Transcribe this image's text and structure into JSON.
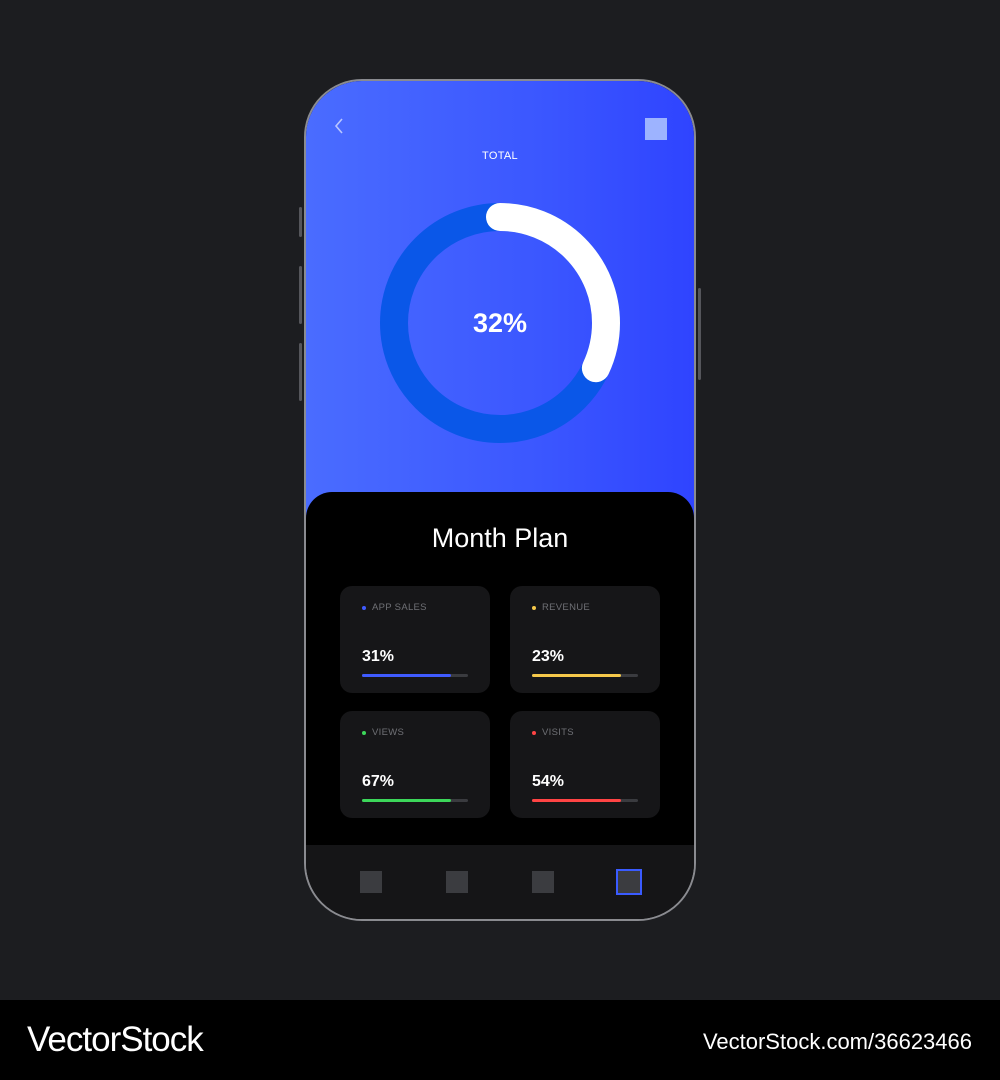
{
  "header": {
    "back_icon": "chevron-left-icon",
    "title": "TOTAL"
  },
  "donut": {
    "value_label": "32%",
    "progress_fraction": 0.32,
    "track_color": "#0a57e8",
    "progress_color": "#ffffff"
  },
  "month_plan": {
    "title": "Month Plan",
    "cards": [
      {
        "label": "APP SALES",
        "value": "31%",
        "fill_fraction": 0.84,
        "color": "#3f5bff"
      },
      {
        "label": "REVENUE",
        "value": "23%",
        "fill_fraction": 0.84,
        "color": "#f5c84a"
      },
      {
        "label": "VIEWS",
        "value": "67%",
        "fill_fraction": 0.84,
        "color": "#3cd75a"
      },
      {
        "label": "VISITS",
        "value": "54%",
        "fill_fraction": 0.84,
        "color": "#ff4444"
      }
    ]
  },
  "tabbar": {
    "tabs": [
      {
        "name": "tab-1",
        "active": false
      },
      {
        "name": "tab-2",
        "active": false
      },
      {
        "name": "tab-3",
        "active": false
      },
      {
        "name": "tab-4",
        "active": true
      }
    ],
    "accent": "#3a5bff"
  },
  "footer": {
    "brand": "VectorStock",
    "image_id": "VectorStock.com/36623466"
  }
}
